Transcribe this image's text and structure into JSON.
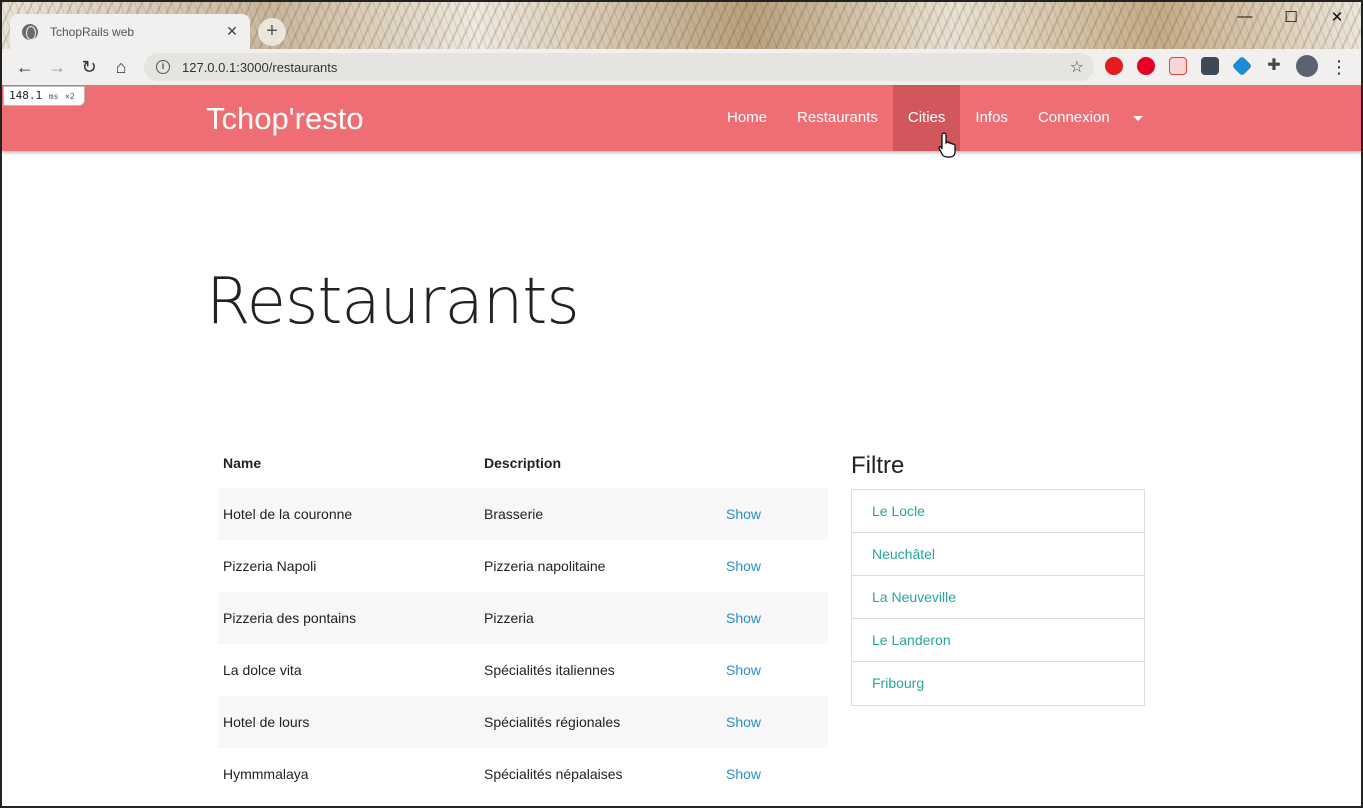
{
  "browser": {
    "tab_title": "TchopRails web",
    "tab_close": "✕",
    "new_tab": "+",
    "url": "127.0.0.1:3000/restaurants",
    "window_controls": [
      "—",
      "☐",
      "✕"
    ],
    "timing_value": "148.1",
    "timing_unit": "ms",
    "timing_mult": "×2"
  },
  "navbar": {
    "brand": "Tchop'resto",
    "links": [
      "Home",
      "Restaurants",
      "Cities",
      "Infos",
      "Connexion"
    ],
    "active": "Cities",
    "background": "#ee6e73"
  },
  "page": {
    "title": "Restaurants"
  },
  "table": {
    "headers": [
      "Name",
      "Description",
      ""
    ],
    "rows": [
      {
        "name": "Hotel de la couronne",
        "description": "Brasserie",
        "action": "Show"
      },
      {
        "name": "Pizzeria Napoli",
        "description": "Pizzeria napolitaine",
        "action": "Show"
      },
      {
        "name": "Pizzeria des pontains",
        "description": "Pizzeria",
        "action": "Show"
      },
      {
        "name": "La dolce vita",
        "description": "Spécialités italiennes",
        "action": "Show"
      },
      {
        "name": "Hotel de lours",
        "description": "Spécialités régionales",
        "action": "Show"
      },
      {
        "name": "Hymmmalaya",
        "description": "Spécialités népalaises",
        "action": "Show"
      }
    ]
  },
  "filter": {
    "title": "Filtre",
    "items": [
      "Le Locle",
      "Neuchâtel",
      "La Neuveville",
      "Le Landeron",
      "Fribourg"
    ]
  }
}
